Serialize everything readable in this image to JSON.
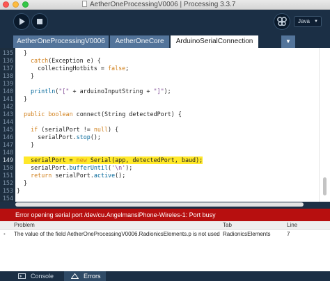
{
  "window": {
    "title": "AetherOneProcessingV0006 | Processing 3.3.7"
  },
  "toolbar": {
    "run_icon": "play-icon",
    "stop_icon": "stop-icon",
    "debug_icon": "butterfly-icon",
    "mode": "Java"
  },
  "tabs": [
    {
      "label": "AetherOneProcessingV0006"
    },
    {
      "label": "AetherOneCore"
    },
    {
      "label": "ArduinoSerialConnection",
      "active": true
    }
  ],
  "editor": {
    "highlighted_line": "149",
    "lines": [
      {
        "n": "135",
        "code": "}"
      },
      {
        "n": "136",
        "code": "catch(Exception e) {"
      },
      {
        "n": "137",
        "code": "  collectingHotbits = false;"
      },
      {
        "n": "138",
        "code": "}"
      },
      {
        "n": "139",
        "code": ""
      },
      {
        "n": "140",
        "code": "println(\"[\" + arduinoInputString + \"]\");"
      },
      {
        "n": "141",
        "code": "}"
      },
      {
        "n": "142",
        "code": ""
      },
      {
        "n": "143",
        "code": "public boolean connect(String detectedPort) {"
      },
      {
        "n": "144",
        "code": ""
      },
      {
        "n": "145",
        "code": "  if (serialPort != null) {"
      },
      {
        "n": "146",
        "code": "    serialPort.stop();"
      },
      {
        "n": "147",
        "code": "  }"
      },
      {
        "n": "148",
        "code": ""
      },
      {
        "n": "149",
        "code": "  serialPort = new Serial(app, detectedPort, baud);"
      },
      {
        "n": "150",
        "code": "  serialPort.bufferUntil('\\n');"
      },
      {
        "n": "151",
        "code": "  return serialPort.active();"
      },
      {
        "n": "152",
        "code": "}"
      },
      {
        "n": "153",
        "code": "}"
      },
      {
        "n": "154",
        "code": ""
      }
    ]
  },
  "status": {
    "message": "Error opening serial port /dev/cu.AngelmansiPhone-Wireles-1: Port busy",
    "color": "#b70f0f"
  },
  "errors": {
    "headers": {
      "problem": "Problem",
      "tab": "Tab",
      "line": "Line"
    },
    "rows": [
      {
        "problem": "The value of the field AetherOneProcessingV0006.RadionicsElements.p is not used",
        "tab": "RadionicsElements",
        "line": "7"
      }
    ]
  },
  "bottom_tabs": [
    {
      "label": "Console",
      "icon": "console-icon"
    },
    {
      "label": "Errors",
      "icon": "warning-icon",
      "active": true
    }
  ]
}
